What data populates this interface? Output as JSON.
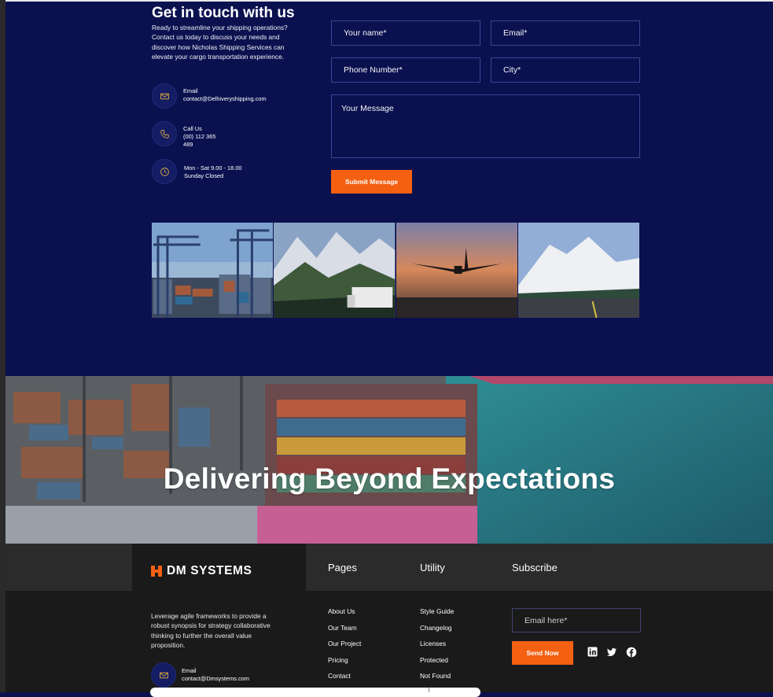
{
  "contact": {
    "title": "Get in touch with us",
    "description": "Ready to streamline your shipping operations? Contact us today to discuss your needs and discover how Nicholas Shipping Services can elevate your cargo transportation experience.",
    "info": [
      {
        "icon": "mail-icon",
        "lines": [
          "Email",
          "contact@Delhiveryshipping.com"
        ]
      },
      {
        "icon": "phone-icon",
        "lines": [
          "Call Us",
          "(00) 112 365",
          "489"
        ]
      },
      {
        "icon": "clock-icon",
        "lines": [
          "Mon - Sat 9.00 - 18.00",
          "Sunday Closed"
        ]
      }
    ],
    "form": {
      "name_placeholder": "Your name*",
      "email_placeholder": "Email*",
      "phone_placeholder": "Phone Number*",
      "city_placeholder": "City*",
      "message_placeholder": "Your Message",
      "submit_label": "Submit Message"
    },
    "gallery": [
      "port-cranes-image",
      "mountain-truck-image",
      "airplane-sunset-image",
      "snowy-mountain-road-image"
    ]
  },
  "hero": {
    "title": "Delivering Beyond Expectations"
  },
  "footer": {
    "logo_text": "DM SYSTEMS",
    "description": "Leverage agile frameworks to provide a robust synopsis for strategy collaborative thinking to further the overall value proposition.",
    "pages_heading": "Pages",
    "utility_heading": "Utility",
    "subscribe_heading": "Subscribe",
    "pages_links": [
      "About Us",
      "Our Team",
      "Our Project",
      "Pricing",
      "Contact"
    ],
    "utility_links": [
      "Style Guide",
      "Changelog",
      "Licenses",
      "Protected",
      "Not Found"
    ],
    "email_placeholder": "Email here*",
    "send_label": "Send Now",
    "social": [
      "linkedin-icon",
      "twitter-icon",
      "facebook-icon"
    ],
    "contact_label": "Email",
    "contact_value": "contact@Dmsystems.com"
  },
  "colors": {
    "navy": "#0b114f",
    "accent": "#f36012",
    "footer_bg": "#1a1a1a",
    "footer_band": "#2b2b2b"
  }
}
